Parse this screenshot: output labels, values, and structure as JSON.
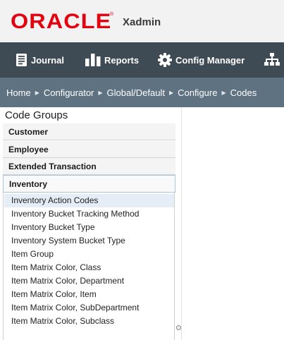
{
  "header": {
    "logo_text": "ORACLE",
    "logo_mark": "®",
    "app_name": "Xadmin",
    "brand_color": "#e3000f"
  },
  "nav": {
    "items": [
      {
        "label": "Journal",
        "icon": "journal-icon"
      },
      {
        "label": "Reports",
        "icon": "bar-chart-icon"
      },
      {
        "label": "Config Manager",
        "icon": "gear-icon"
      },
      {
        "label": "",
        "icon": "sitemap-icon"
      }
    ]
  },
  "breadcrumb": {
    "items": [
      "Home",
      "Configurator",
      "Global/Default",
      "Configure",
      "Codes"
    ],
    "separator": "▶"
  },
  "sidebar": {
    "title": "Code Groups",
    "groups": [
      "Customer",
      "Employee",
      "Extended Transaction",
      "Inventory"
    ],
    "active_group": "Inventory",
    "codes": [
      "Inventory Action Codes",
      "Inventory Bucket Tracking Method",
      "Inventory Bucket Type",
      "Inventory System Bucket Type",
      "Item Group",
      "Item Matrix Color, Class",
      "Item Matrix Color, Department",
      "Item Matrix Color, Item",
      "Item Matrix Color, SubDepartment",
      "Item Matrix Color, Subclass"
    ],
    "selected_code": "Inventory Action Codes"
  }
}
